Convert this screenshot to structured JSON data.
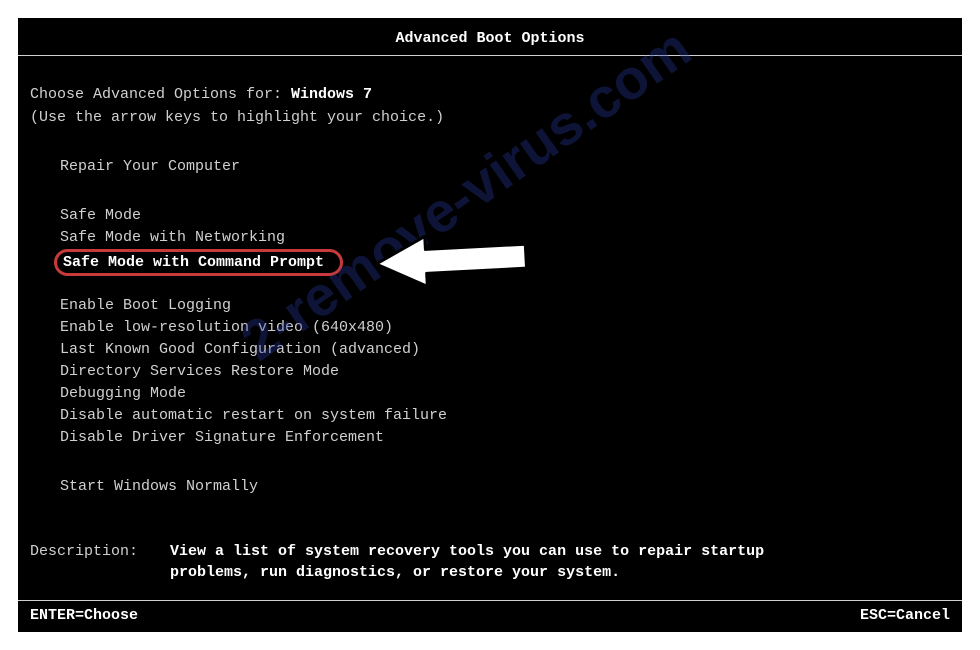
{
  "title": "Advanced Boot Options",
  "prompt": {
    "prefix": "Choose Advanced Options for: ",
    "os": "Windows 7",
    "hint": "(Use the arrow keys to highlight your choice.)"
  },
  "menu": {
    "repair": "Repair Your Computer",
    "safe": {
      "safe_mode": "Safe Mode",
      "safe_mode_net": "Safe Mode with Networking",
      "safe_mode_cmd": "Safe Mode with Command Prompt"
    },
    "advanced": {
      "boot_logging": "Enable Boot Logging",
      "low_res": "Enable low-resolution video (640x480)",
      "last_known": "Last Known Good Configuration (advanced)",
      "ds_restore": "Directory Services Restore Mode",
      "debug": "Debugging Mode",
      "no_auto_restart": "Disable automatic restart on system failure",
      "no_sig_enforce": "Disable Driver Signature Enforcement"
    },
    "normal": "Start Windows Normally"
  },
  "description": {
    "label": "Description:",
    "text": "View a list of system recovery tools you can use to repair startup problems, run diagnostics, or restore your system."
  },
  "footer": {
    "enter": "ENTER=Choose",
    "esc": "ESC=Cancel"
  },
  "watermark": "2-remove-virus.com",
  "colors": {
    "highlight_border": "#c83a3a",
    "watermark": "#2a3a9e"
  }
}
